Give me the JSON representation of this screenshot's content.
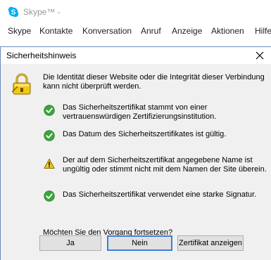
{
  "skype": {
    "title": "Skype™ -",
    "menu": [
      "Skype",
      "Kontakte",
      "Konversation",
      "Anruf",
      "Anzeige",
      "Aktionen",
      "Hilfe"
    ]
  },
  "dialog": {
    "title": "Sicherheitshinweis",
    "intro": "Die Identität dieser Website oder die Integrität dieser Verbindung kann nicht überprüft werden.",
    "checks": [
      {
        "status": "ok",
        "icon": "check-icon",
        "text": "Das Sicherheitszertifikat stammt von einer vertrauenswürdigen Zertifizierungsinstitution."
      },
      {
        "status": "ok",
        "icon": "check-icon",
        "text": "Das Datum des Sicherheitszertifikates ist gültig."
      },
      {
        "status": "warning",
        "icon": "warning-icon",
        "text": "Der auf dem Sicherheitszertifikat angegebene Name ist ungültig oder stimmt nicht mit dem Namen der Site überein."
      },
      {
        "status": "ok",
        "icon": "check-icon",
        "text": "Das Sicherheitszertifikat verwendet eine starke Signatur."
      }
    ],
    "question": "Möchten Sie den Vorgang fortsetzen?",
    "buttons": {
      "yes": "Ja",
      "no": "Nein",
      "view_cert": "Zertifikat anzeigen"
    }
  },
  "colors": {
    "ok": "#3aa63a",
    "warning": "#f2c811",
    "accent": "#3b7fd9",
    "skype_blue": "#00aff0"
  }
}
